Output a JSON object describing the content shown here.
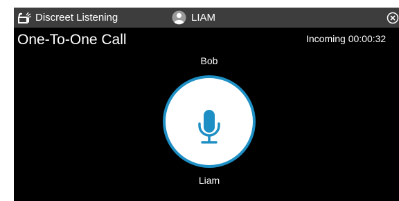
{
  "window": {
    "title": "Discreet Listening",
    "app_icon": "discreet-listening-icon",
    "user_icon": "user-avatar-icon",
    "user_name": "LIAM",
    "close_icon": "close-icon"
  },
  "call": {
    "type": "One-To-One Call",
    "status": "Incoming 00:00:32",
    "remote_party": "Bob",
    "local_party": "Liam",
    "mic_icon": "microphone-icon"
  },
  "colors": {
    "background": "#000000",
    "titlebar": "#3d3d3d",
    "accent": "#1e8fc4",
    "text": "#ffffff"
  }
}
